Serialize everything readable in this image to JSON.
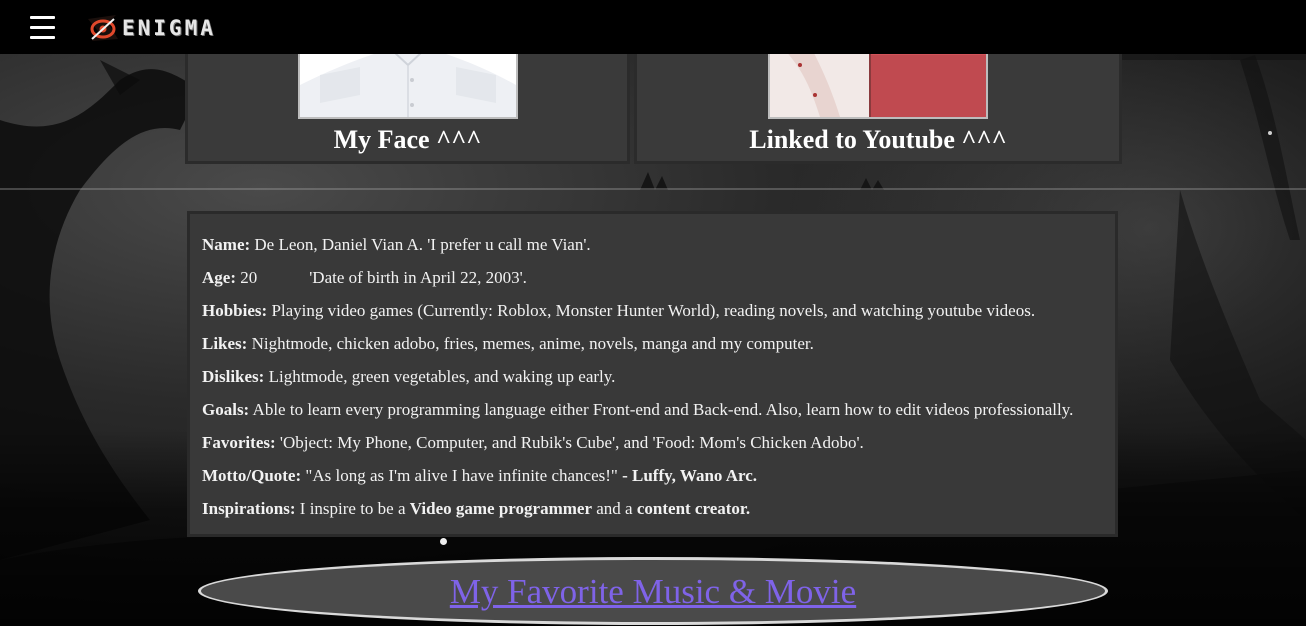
{
  "brand": {
    "name": "ENIGMA",
    "accent": "#e0482b"
  },
  "nav": {
    "menu_icon": "hamburger-menu-icon"
  },
  "cards": [
    {
      "caption": "My Face ^^^",
      "media": "profile-photo"
    },
    {
      "caption": "Linked to Youtube ^^^",
      "media": "youtube-thumbnail"
    }
  ],
  "info": {
    "name_label": "Name:",
    "name_value": "De Leon, Daniel Vian A. 'I prefer u call me Vian'.",
    "age_label": "Age:",
    "age_value": "20",
    "age_note": "'Date of birth in April 22, 2003'.",
    "hobbies_label": "Hobbies:",
    "hobbies_value": "Playing video games (Currently: Roblox, Monster Hunter World), reading novels, and watching youtube videos.",
    "likes_label": "Likes:",
    "likes_value": "Nightmode, chicken adobo, fries, memes, anime, novels, manga and my computer.",
    "dislikes_label": "Dislikes:",
    "dislikes_value": "Lightmode, green vegetables, and waking up early.",
    "goals_label": "Goals:",
    "goals_value": "Able to learn every programming language either Front-end and Back-end. Also, learn how to edit videos professionally.",
    "favorites_label": "Favorites:",
    "favorites_value": "'Object: My Phone, Computer, and Rubik's Cube', and 'Food: Mom's Chicken Adobo'.",
    "motto_label": "Motto/Quote:",
    "motto_value": "\"As long as I'm alive I have infinite chances!\"",
    "motto_author": "- Luffy, Wano Arc.",
    "inspirations_label": "Inspirations:",
    "inspirations_pre": "I inspire to be a",
    "inspirations_role1": "Video game programmer",
    "inspirations_mid": "and a",
    "inspirations_role2": "content creator."
  },
  "fav_link": {
    "label": "My Favorite Music & Movie",
    "color": "#7f63e8"
  }
}
